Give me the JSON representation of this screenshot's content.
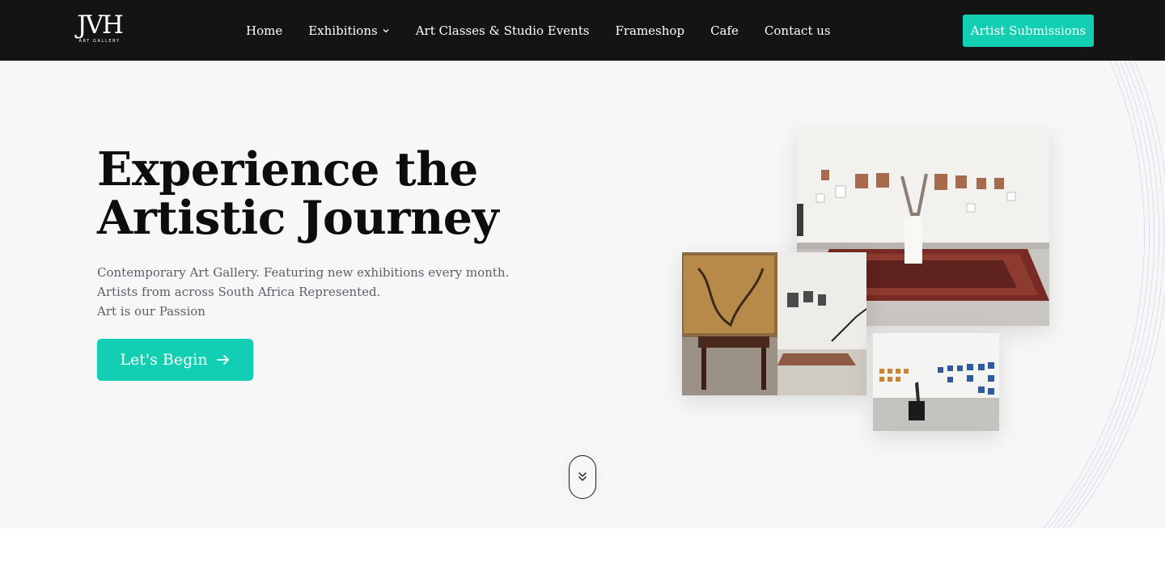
{
  "logo": {
    "mark": "JVH",
    "sub": "ART GALLERY",
    "icon": "jvh-logo-icon"
  },
  "nav": {
    "links": [
      {
        "label": "Home"
      },
      {
        "label": "Exhibitions",
        "icon": "chevron-down-icon"
      },
      {
        "label": "Art Classes & Studio Events"
      },
      {
        "label": "Frameshop"
      },
      {
        "label": "Cafe"
      },
      {
        "label": "Contact us"
      }
    ],
    "cta_label": "Artist Submissions"
  },
  "hero": {
    "title": "Experience the Artistic Journey",
    "lines": [
      "Contemporary Art Gallery. Featuring new exhibitions every month.",
      "Artists from across South Africa Represented.",
      "Art is our Passion"
    ],
    "button_label": "Let's Begin",
    "button_icon": "arrow-right-icon",
    "scroll_icon": "double-chevron-down-icon"
  },
  "colors": {
    "nav_bg": "#141414",
    "accent": "#12cfb3",
    "hero_bg": "#f7f7f7",
    "body_text": "#5e5e6a"
  }
}
